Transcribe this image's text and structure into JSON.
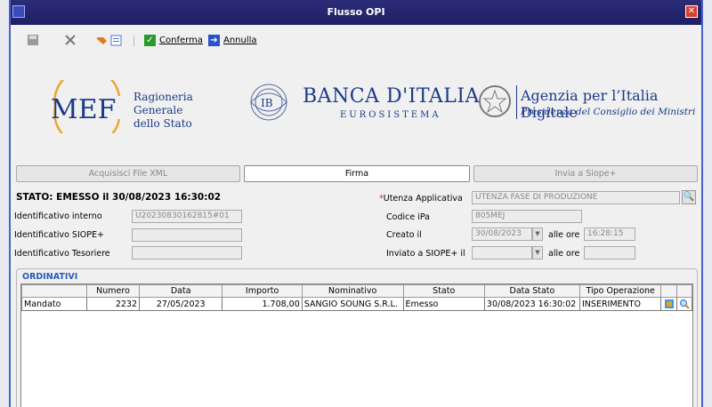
{
  "window": {
    "title": "Flusso OPI"
  },
  "toolbar": {
    "confirm_label": "Conferma",
    "cancel_label": "Annulla"
  },
  "logos": {
    "mef_text": "MEF",
    "mef_line1": "Ragioneria",
    "mef_line2": "Generale",
    "mef_line3": "dello Stato",
    "bdi_name": "BANCA D'ITALIA",
    "bdi_sub": "EUROSISTEMA",
    "agid_name": "Agenzia per l’Italia Digitale",
    "agid_sub": "Presidenza del Consiglio dei Ministri"
  },
  "tabs": [
    {
      "label": "Acquisisci File XML",
      "active": false
    },
    {
      "label": "Firma",
      "active": true
    },
    {
      "label": "Invia a Siope+",
      "active": false
    }
  ],
  "form": {
    "status": "STATO: EMESSO il 30/08/2023 16:30:02",
    "id_interno_label": "Identificativo interno",
    "id_interno_value": "U20230830162815#01",
    "id_siope_label": "Identificativo SIOPE+",
    "id_siope_value": "",
    "id_tesoriere_label": "Identificativo Tesoriere",
    "id_tesoriere_value": "",
    "utenza_label": "Utenza Applicativa",
    "utenza_value": "UTENZA FASE DI PRODUZIONE",
    "ipa_label": "Codice iPa",
    "ipa_value": "805MEJ",
    "creato_label": "Creato il",
    "creato_date": "30/08/2023",
    "alle_ore_label": "alle ore",
    "creato_time": "16:28:15",
    "inviato_label": "Inviato a SIOPE+ il",
    "inviato_date": "",
    "inviato_time": ""
  },
  "ordinativi": {
    "title": "ORDINATIVI",
    "columns": [
      "",
      "Numero",
      "Data",
      "Importo",
      "Nominativo",
      "Stato",
      "Data Stato",
      "Tipo Operazione",
      "",
      ""
    ],
    "rows": [
      [
        "Mandato",
        "2232",
        "27/05/2023",
        "1.708,00",
        "SANGIO SOUNG S.R.L.",
        "Emesso",
        "30/08/2023 16:30:02",
        "INSERIMENTO"
      ]
    ]
  }
}
